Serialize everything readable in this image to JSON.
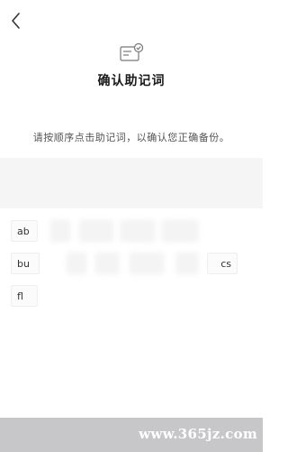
{
  "header": {
    "back_icon": "chevron-left-icon",
    "header_icon": "verified-card-icon",
    "title": "确认助记词"
  },
  "instruction": "请按顺序点击助记词，以确认您正确备份。",
  "words": {
    "row1": [
      "ab",
      "",
      "",
      "",
      ""
    ],
    "row2": [
      "bu",
      "",
      "",
      "",
      "",
      "cs"
    ],
    "row3": [
      "fl"
    ]
  },
  "watermark": "www.365jz.com"
}
